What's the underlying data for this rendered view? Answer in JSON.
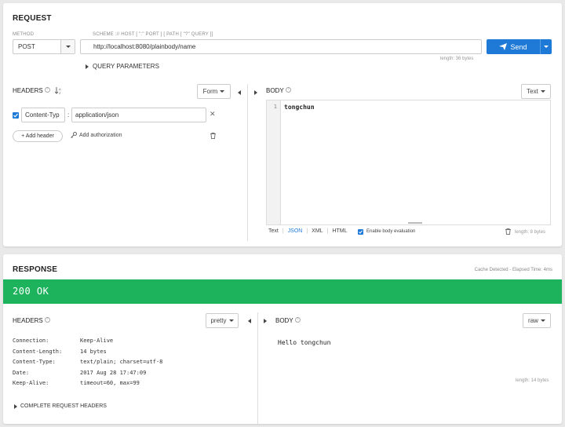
{
  "request": {
    "title": "REQUEST",
    "method_label": "METHOD",
    "method_value": "POST",
    "url_label": "SCHEME :// HOST [ \":\" PORT ] [ PATH [ \"?\" QUERY ]]",
    "url_value": "http://localhost:8080/plainbody/name",
    "url_length": "length: 36 bytes",
    "send_label": "Send",
    "query_params_label": "QUERY PARAMETERS"
  },
  "headers": {
    "title": "HEADERS",
    "help": "?",
    "mode": "Form",
    "items": [
      {
        "name": "Content-Typ",
        "value": "application/json",
        "enabled": true
      }
    ],
    "add_header_label": "+ Add header",
    "add_auth_label": "Add authorization"
  },
  "body": {
    "title": "BODY",
    "help": "?",
    "format": "Text",
    "line_number": "1",
    "content": "tongchun",
    "tabs": [
      "Text",
      "JSON",
      "XML",
      "HTML"
    ],
    "active_tab": "JSON",
    "eval_label": "Enable body evaluation",
    "length": "length: 8 bytes"
  },
  "response": {
    "title": "RESPONSE",
    "meta": "Cache Detected - Elapsed Time: 4ms",
    "status": "200 OK",
    "status_color": "#1cb35c",
    "headers_title": "HEADERS",
    "headers_mode": "pretty",
    "header_rows": [
      {
        "key": "Connection:",
        "value": "Keep-Alive"
      },
      {
        "key": "Content-Length:",
        "value": "14 bytes"
      },
      {
        "key": "Content-Type:",
        "value": "text/plain; charset=utf-8"
      },
      {
        "key": "Date:",
        "value": "2017 Aug 28 17:47:09"
      },
      {
        "key": "Keep-Alive:",
        "value": "timeout=60, max=99"
      }
    ],
    "complete_headers_label": "COMPLETE REQUEST HEADERS",
    "body_title": "BODY",
    "body_mode": "raw",
    "body_content": "Hello tongchun",
    "body_length": "length: 14 bytes"
  },
  "colors": {
    "accent": "#1e7ad6",
    "success": "#1cb35c"
  }
}
